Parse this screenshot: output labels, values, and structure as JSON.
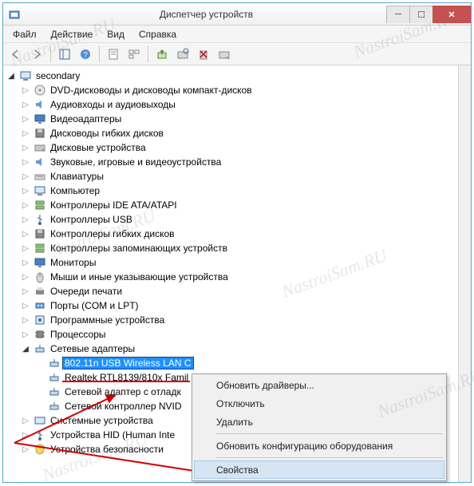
{
  "window": {
    "title": "Диспетчер устройств"
  },
  "menu": {
    "file": "Файл",
    "action": "Действие",
    "view": "Вид",
    "help": "Справка"
  },
  "tree": {
    "root": "secondary",
    "items": [
      "DVD-дисководы и дисководы компакт-дисков",
      "Аудиовходы и аудиовыходы",
      "Видеоадаптеры",
      "Дисководы гибких дисков",
      "Дисковые устройства",
      "Звуковые, игровые и видеоустройства",
      "Клавиатуры",
      "Компьютер",
      "Контроллеры IDE ATA/ATAPI",
      "Контроллеры USB",
      "Контроллеры гибких дисков",
      "Контроллеры запоминающих устройств",
      "Мониторы",
      "Мыши и иные указывающие устройства",
      "Очереди печати",
      "Порты (COM и LPT)",
      "Программные устройства",
      "Процессоры"
    ],
    "network_label": "Сетевые адаптеры",
    "network_children": [
      "802.11n USB Wireless LAN C",
      "Realtek RTL8139/810x Famil",
      "Сетевой адаптер с отладк",
      "Сетевой контроллер NVID"
    ],
    "after": [
      "Системные устройства",
      "Устройства HID (Human Inte",
      "Устройства безопасности"
    ]
  },
  "context_menu": {
    "update": "Обновить драйверы...",
    "disable": "Отключить",
    "remove": "Удалить",
    "scan": "Обновить конфигурацию оборудования",
    "props": "Свойства"
  },
  "watermark": "NastroiSam.RU"
}
